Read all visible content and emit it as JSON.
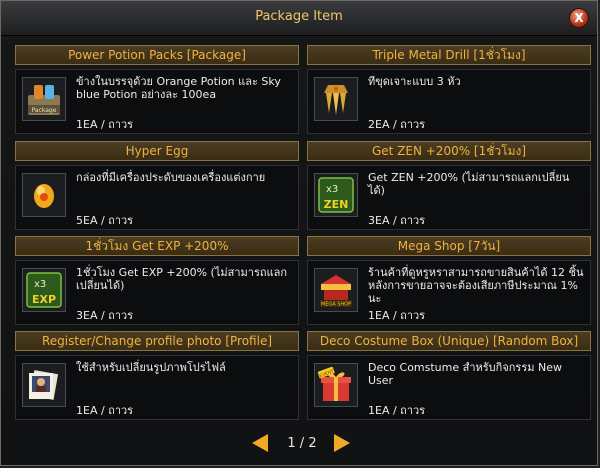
{
  "dialog": {
    "title": "Package Item",
    "close_label": "X"
  },
  "items": [
    {
      "name": "Power Potion Packs [Package]",
      "description": "ข้างในบรรจุด้วย Orange Potion และ Sky blue Potion อย่างละ 100ea",
      "quantity": "1EA / ถาวร",
      "icon": "potion-package-icon"
    },
    {
      "name": "Triple Metal Drill [1ชั่วโมง]",
      "description": "ทีขุดเจาะแบบ 3 หัว",
      "quantity": "2EA / ถาวร",
      "icon": "drill-icon"
    },
    {
      "name": "Hyper Egg",
      "description": "กล่องที่มีเครื่องประดับของเครื่องแต่งกาย",
      "quantity": "5EA / ถาวร",
      "icon": "egg-icon"
    },
    {
      "name": "Get ZEN +200% [1ชั่วโมง]",
      "description": "Get ZEN +200% (ไม่สามารถแลกเปลี่ยนได้)",
      "quantity": "3EA / ถาวร",
      "icon": "zen-x3-icon",
      "icon_text": "ZEN",
      "icon_mult": "x3"
    },
    {
      "name": "1ชั่วโมง Get EXP +200%",
      "description": "1ชั่วโมง Get EXP +200% (ไม่สามารถแลกเปลี่ยนได้)",
      "quantity": "3EA / ถาวร",
      "icon": "exp-x3-icon",
      "icon_text": "EXP",
      "icon_mult": "x3"
    },
    {
      "name": "Mega Shop [7วัน]",
      "description": "ร้านค้าที่ดูหรูหราสามารถขายสินค้าได้ 12 ชิ้น หลังการขายอาจจะต้องเสียภาษีประมาณ 1% นะ",
      "quantity": "1EA / ถาวร",
      "icon": "mega-shop-icon",
      "icon_text": "MEGA SHOP"
    },
    {
      "name": "Register/Change profile photo [Profile]",
      "description": "ใช้สำหรับเปลี่ยนรูปภาพโปรไฟล์",
      "quantity": "1EA / ถาวร",
      "icon": "photo-icon"
    },
    {
      "name": "Deco Costume Box (Unique) [Random Box]",
      "description": "Deco Comstume สำหรับกิจกรรม New User",
      "quantity": "1EA / ถาวร",
      "icon": "gift-box-icon",
      "icon_text": "EVENT"
    }
  ],
  "pagination": {
    "text": "1 / 2"
  },
  "colors": {
    "header_text": "#f2b23e",
    "title_text": "#f0c868",
    "arrow": "#f4a82a"
  }
}
